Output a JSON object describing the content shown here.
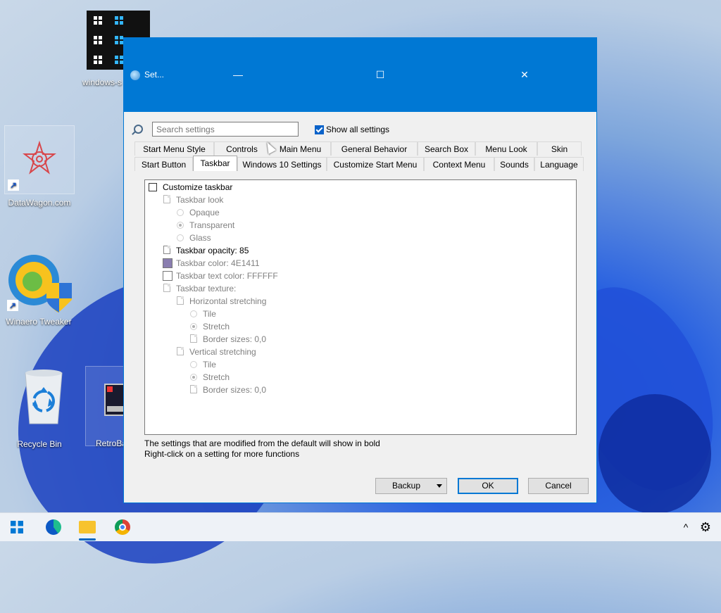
{
  "desktop": {
    "icons": [
      {
        "label": "windows-s"
      },
      {
        "label": "DataWagon.com"
      },
      {
        "label": "Winaero Tweaker"
      },
      {
        "label": "Recycle Bin"
      },
      {
        "label": "RetroBa"
      }
    ]
  },
  "dialog": {
    "title": "Set...",
    "controls": {
      "minimize": "—",
      "maximize": "☐",
      "close": "✕"
    },
    "search": {
      "placeholder": "Search settings",
      "value": ""
    },
    "show_all": {
      "label": "Show all settings",
      "checked": true
    },
    "tabs_row1": [
      "Start Menu Style",
      "Controls",
      "Main Menu",
      "General Behavior",
      "Search Box",
      "Menu Look",
      "Skin"
    ],
    "tabs_row2": [
      "Start Button",
      "Taskbar",
      "Windows 10 Settings",
      "Customize Start Menu",
      "Context Menu",
      "Sounds",
      "Language"
    ],
    "selected_tab": "Taskbar",
    "settings": {
      "customize_taskbar": "Customize taskbar",
      "taskbar_look": "Taskbar look",
      "opaque": "Opaque",
      "transparent": "Transparent",
      "glass": "Glass",
      "opacity": "Taskbar opacity: 85",
      "color": "Taskbar color: 4E1411",
      "color_swatch": "#8a7eb0",
      "text_color": "Taskbar text color: FFFFFF",
      "texture": "Taskbar texture:",
      "horizontal": "Horizontal stretching",
      "h_tile": "Tile",
      "h_stretch": "Stretch",
      "h_border": "Border sizes: 0,0",
      "vertical": "Vertical stretching",
      "v_tile": "Tile",
      "v_stretch": "Stretch",
      "v_border": "Border sizes: 0,0"
    },
    "notes": {
      "line1": "The settings that are modified from the default will show in bold",
      "line2": "Right-click on a setting for more functions"
    },
    "buttons": {
      "backup": "Backup",
      "ok": "OK",
      "cancel": "Cancel"
    }
  },
  "taskbar": {
    "apps": [
      "start-icon",
      "edge-icon",
      "file-explorer-icon",
      "chrome-icon"
    ],
    "tray": {
      "chevron": "^",
      "settings": "⚙"
    }
  },
  "colors": {
    "accent": "#0078d4"
  }
}
